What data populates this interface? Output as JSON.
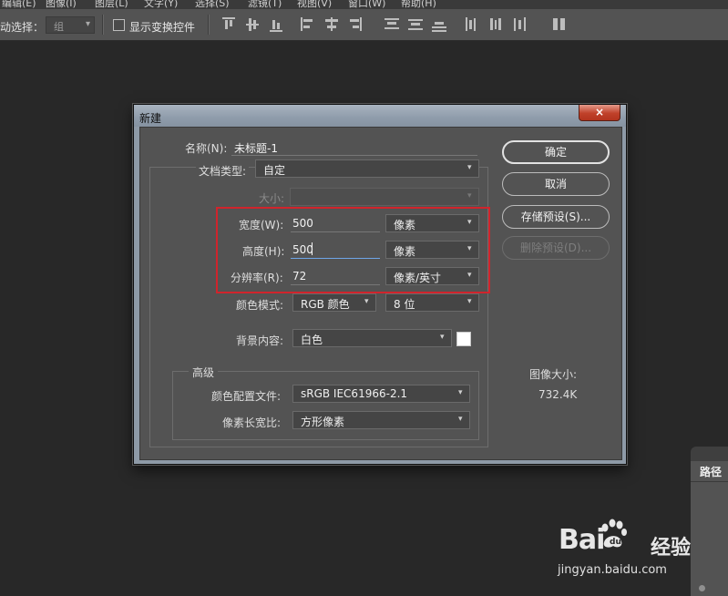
{
  "menubar": {
    "items": [
      "编辑(E)",
      "图像(I)",
      "图层(L)",
      "文字(Y)",
      "选择(S)",
      "滤镜(T)",
      "视图(V)",
      "窗口(W)",
      "帮助(H)"
    ]
  },
  "options_bar": {
    "auto_select_label": "动选择：",
    "auto_select_value": "组",
    "show_transform_label": "显示变换控件",
    "show_transform_checked": false
  },
  "right_panel": {
    "tab_label": "路径"
  },
  "dialog": {
    "title": "新建",
    "close_symbol": "×",
    "name_label": "名称(N):",
    "name_value": "未标题-1",
    "preset_label": "文档类型:",
    "preset_value": "自定",
    "size_label": "大小:",
    "size_value": "",
    "width_label": "宽度(W):",
    "width_value": "500",
    "width_unit": "像素",
    "height_label": "高度(H):",
    "height_value": "500",
    "height_unit": "像素",
    "resolution_label": "分辨率(R):",
    "resolution_value": "72",
    "resolution_unit": "像素/英寸",
    "color_mode_label": "颜色模式:",
    "color_mode_value": "RGB 颜色",
    "bit_depth_value": "8 位",
    "background_label": "背景内容:",
    "background_value": "白色",
    "background_swatch": "#ffffff",
    "advanced_label": "高级",
    "color_profile_label": "颜色配置文件:",
    "color_profile_value": "sRGB IEC61966-2.1",
    "pixel_aspect_label": "像素长宽比:",
    "pixel_aspect_value": "方形像素",
    "image_size_label": "图像大小:",
    "image_size_value": "732.4K",
    "buttons": {
      "ok": "确定",
      "cancel": "取消",
      "save_preset": "存储预设(S)...",
      "delete_preset": "删除预设(D)..."
    },
    "highlight_color": "#d0242c"
  },
  "watermark": {
    "brand": "Bai",
    "brand_suffix": "经验",
    "url": "jingyan.baidu.com"
  }
}
